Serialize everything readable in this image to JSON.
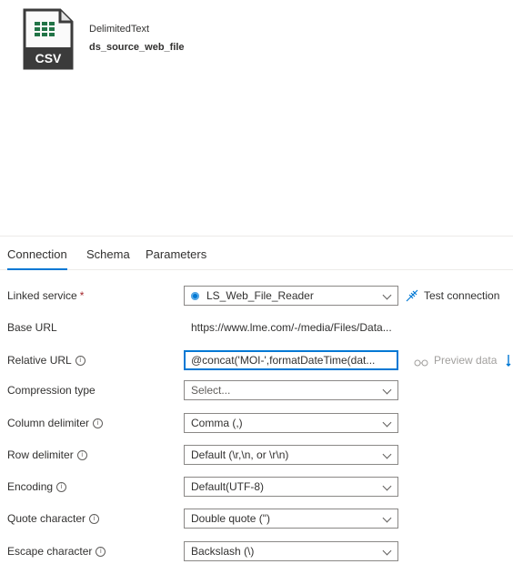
{
  "dataset": {
    "type": "DelimitedText",
    "name": "ds_source_web_file",
    "icon_text": "CSV",
    "icon": "csv-file-icon"
  },
  "tabs": [
    {
      "label": "Connection",
      "active": true
    },
    {
      "label": "Schema",
      "active": false
    },
    {
      "label": "Parameters",
      "active": false
    }
  ],
  "form": {
    "linked_service": {
      "label": "Linked service",
      "required_mark": "*",
      "value": "LS_Web_File_Reader",
      "action": "Test connection"
    },
    "base_url": {
      "label": "Base URL",
      "value": "https://www.lme.com/-/media/Files/Data..."
    },
    "relative_url": {
      "label": "Relative URL",
      "value": "@concat('MOI-',formatDateTime(dat...",
      "action": "Preview data"
    },
    "compression_type": {
      "label": "Compression type",
      "value": "Select..."
    },
    "column_delimiter": {
      "label": "Column delimiter",
      "value": "Comma (,)"
    },
    "row_delimiter": {
      "label": "Row delimiter",
      "value": "Default (\\r,\\n, or \\r\\n)"
    },
    "encoding": {
      "label": "Encoding",
      "value": "Default(UTF-8)"
    },
    "quote_character": {
      "label": "Quote character",
      "value": "Double quote (\")"
    },
    "escape_character": {
      "label": "Escape character",
      "value": "Backslash (\\)"
    }
  },
  "colors": {
    "accent": "#0078d4",
    "required": "#a4262c",
    "csv_green": "#217346"
  }
}
